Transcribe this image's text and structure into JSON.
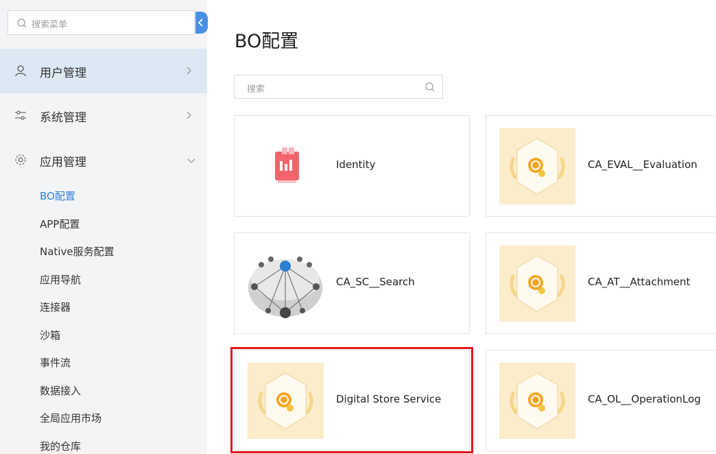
{
  "sidebar": {
    "search": {
      "placeholder": "搜索菜单"
    },
    "collapse_icon": "chevron-left-icon",
    "menu": [
      {
        "label": "用户管理",
        "icon": "user-icon",
        "state": "active",
        "chevron": "right"
      },
      {
        "label": "系统管理",
        "icon": "settings-sliders-icon",
        "chevron": "right"
      },
      {
        "label": "应用管理",
        "icon": "gear-icon",
        "chevron": "down"
      }
    ],
    "submenu": [
      {
        "label": "BO配置",
        "selected": true
      },
      {
        "label": "APP配置"
      },
      {
        "label": "Native服务配置"
      },
      {
        "label": "应用导航"
      },
      {
        "label": "连接器"
      },
      {
        "label": "沙箱"
      },
      {
        "label": "事件流"
      },
      {
        "label": "数据接入"
      },
      {
        "label": "全局应用市场"
      },
      {
        "label": "我的仓库"
      }
    ]
  },
  "main": {
    "title": "BO配置",
    "search": {
      "placeholder": "搜索"
    },
    "cards": [
      {
        "label": "Identity",
        "thumb": "identity-icon"
      },
      {
        "label": "CA_EVAL__Evaluation",
        "thumb": "badge-icon"
      },
      {
        "label": "CA_SC__Search",
        "thumb": "network-sphere-image"
      },
      {
        "label": "CA_AT__Attachment",
        "thumb": "badge-icon"
      },
      {
        "label": "Digital Store Service",
        "thumb": "badge-icon",
        "highlighted": true
      },
      {
        "label": "CA_OL__OperationLog",
        "thumb": "badge-icon"
      }
    ]
  },
  "colors": {
    "accent": "#2f7fd8",
    "active_bg": "#dce8f3",
    "highlight_border": "#e0161b",
    "sidebar_bg": "#f3f4f6"
  }
}
